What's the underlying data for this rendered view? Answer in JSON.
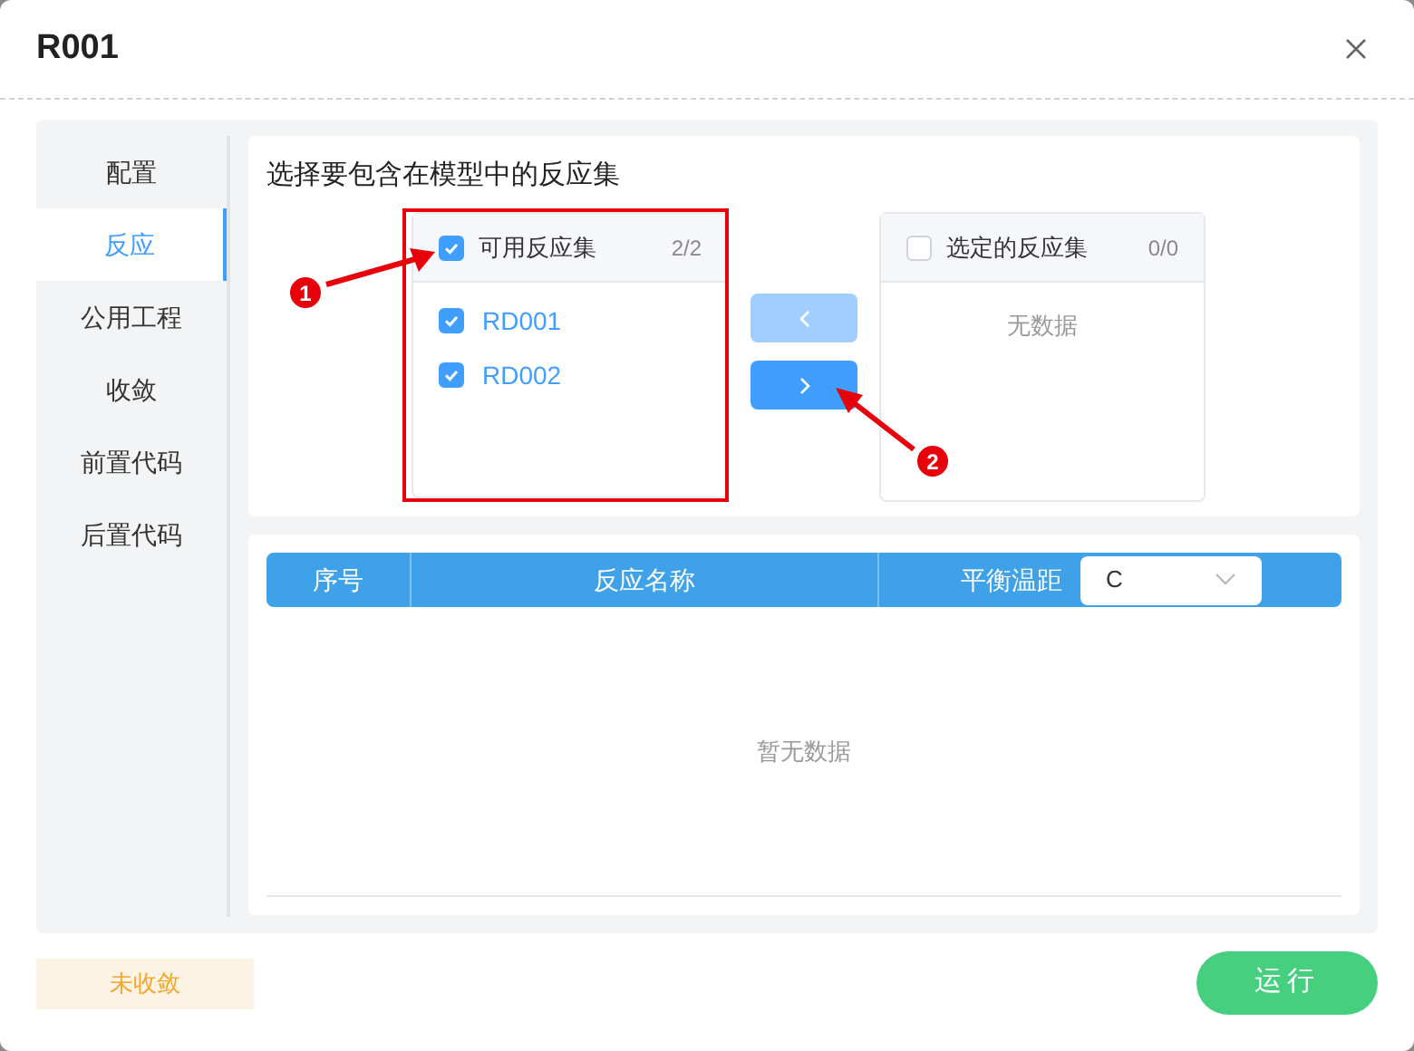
{
  "dialog": {
    "title": "R001"
  },
  "sidebar": {
    "items": [
      {
        "label": "配置",
        "selected": false
      },
      {
        "label": "反应",
        "selected": true
      },
      {
        "label": "公用工程",
        "selected": false
      },
      {
        "label": "收敛",
        "selected": false
      },
      {
        "label": "前置代码",
        "selected": false
      },
      {
        "label": "后置代码",
        "selected": false
      }
    ]
  },
  "section_title": "选择要包含在模型中的反应集",
  "transfer": {
    "source": {
      "title": "可用反应集",
      "count": "2/2",
      "checked": true,
      "items": [
        {
          "label": "RD001",
          "checked": true
        },
        {
          "label": "RD002",
          "checked": true
        }
      ]
    },
    "target": {
      "title": "选定的反应集",
      "count": "0/0",
      "checked": false,
      "empty_text": "无数据"
    },
    "buttons": [
      {
        "kind": "left",
        "disabled": true
      },
      {
        "kind": "right",
        "disabled": false
      }
    ]
  },
  "table": {
    "columns": [
      "序号",
      "反应名称",
      "平衡温距"
    ],
    "unit_select": {
      "value": "C"
    },
    "empty_text": "暂无数据"
  },
  "footer": {
    "status": "未收敛",
    "run_button": "运行"
  },
  "annotations": [
    {
      "number": "1"
    },
    {
      "number": "2"
    }
  ]
}
